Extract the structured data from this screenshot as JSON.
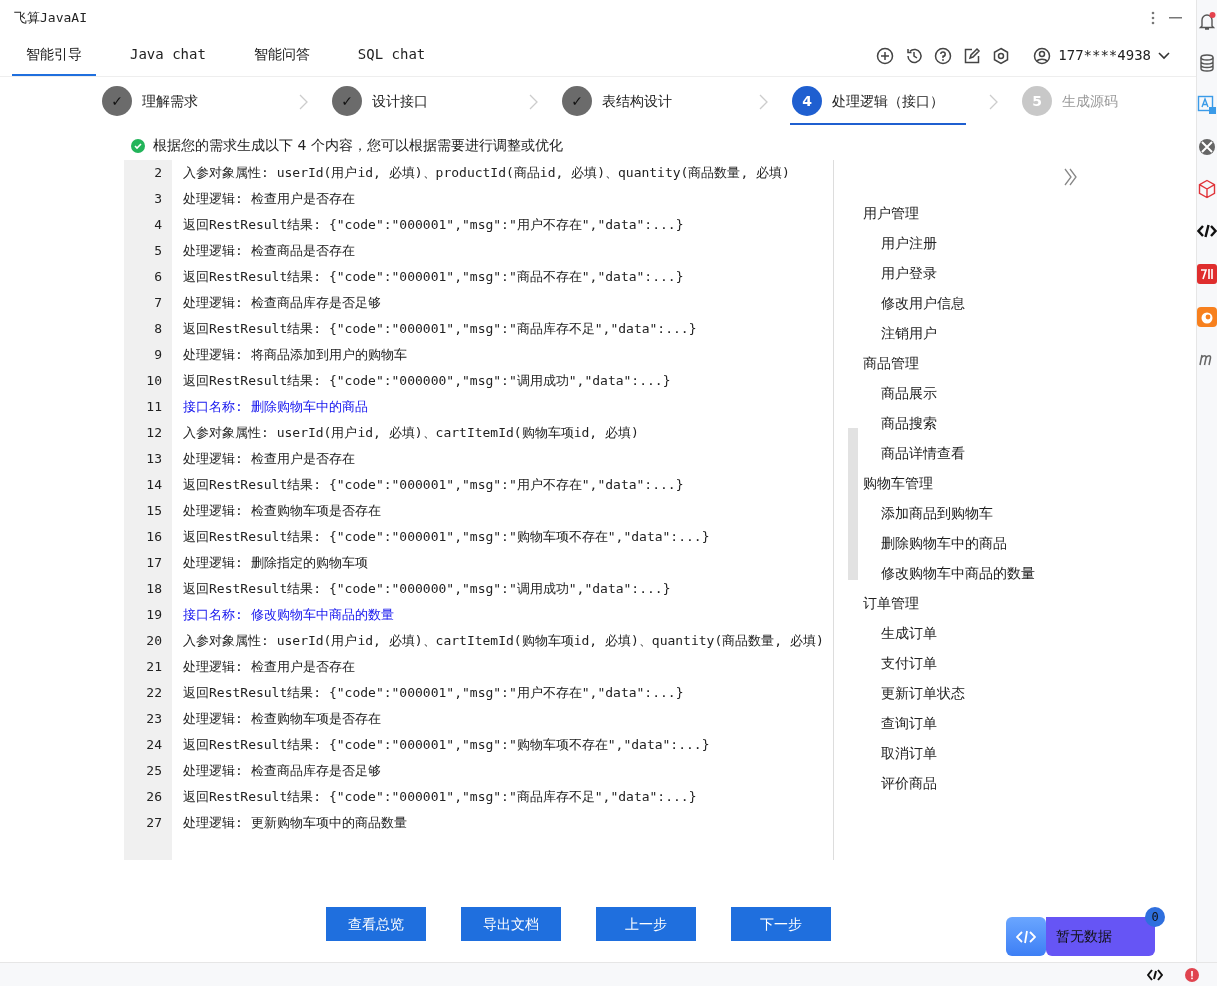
{
  "window": {
    "title": "飞算JavaAI"
  },
  "tabs": [
    {
      "label": "智能引导",
      "selected": true
    },
    {
      "label": "Java chat",
      "selected": false
    },
    {
      "label": "智能问答",
      "selected": false
    },
    {
      "label": "SQL chat",
      "selected": false
    }
  ],
  "account": {
    "label": "177****4938"
  },
  "steps": [
    {
      "marker": "✓",
      "label": "理解需求",
      "completed": true,
      "selected": false
    },
    {
      "marker": "✓",
      "label": "设计接口",
      "completed": true,
      "selected": false
    },
    {
      "marker": "✓",
      "label": "表结构设计",
      "completed": true,
      "selected": false
    },
    {
      "marker": "4",
      "label": "处理逻辑（接口）",
      "completed": false,
      "selected": true
    },
    {
      "marker": "5",
      "label": "生成源码",
      "completed": false,
      "selected": false
    }
  ],
  "message": "根据您的需求生成以下 4 个内容，您可以根据需要进行调整或优化",
  "code_lines": [
    {
      "number": "2",
      "text": "入参对象属性: userId(用户id, 必填)、productId(商品id, 必填)、quantity(商品数量, 必填)",
      "kind": "text"
    },
    {
      "number": "3",
      "text": "处理逻辑: 检查用户是否存在",
      "kind": "text"
    },
    {
      "number": "4",
      "text": "返回RestResult结果: {\"code\":\"000001\",\"msg\":\"用户不存在\",\"data\":...}",
      "kind": "text"
    },
    {
      "number": "5",
      "text": "处理逻辑: 检查商品是否存在",
      "kind": "text"
    },
    {
      "number": "6",
      "text": "返回RestResult结果: {\"code\":\"000001\",\"msg\":\"商品不存在\",\"data\":...}",
      "kind": "text"
    },
    {
      "number": "7",
      "text": "处理逻辑: 检查商品库存是否足够",
      "kind": "text"
    },
    {
      "number": "8",
      "text": "返回RestResult结果: {\"code\":\"000001\",\"msg\":\"商品库存不足\",\"data\":...}",
      "kind": "text"
    },
    {
      "number": "9",
      "text": "处理逻辑: 将商品添加到用户的购物车",
      "kind": "text"
    },
    {
      "number": "10",
      "text": "返回RestResult结果: {\"code\":\"000000\",\"msg\":\"调用成功\",\"data\":...}",
      "kind": "text"
    },
    {
      "number": "11",
      "text": "接口名称: 删除购物车中的商品",
      "kind": "heading"
    },
    {
      "number": "12",
      "text": "入参对象属性: userId(用户id, 必填)、cartItemId(购物车项id, 必填)",
      "kind": "text"
    },
    {
      "number": "13",
      "text": "处理逻辑: 检查用户是否存在",
      "kind": "text"
    },
    {
      "number": "14",
      "text": "返回RestResult结果: {\"code\":\"000001\",\"msg\":\"用户不存在\",\"data\":...}",
      "kind": "text"
    },
    {
      "number": "15",
      "text": "处理逻辑: 检查购物车项是否存在",
      "kind": "text"
    },
    {
      "number": "16",
      "text": "返回RestResult结果: {\"code\":\"000001\",\"msg\":\"购物车项不存在\",\"data\":...}",
      "kind": "text"
    },
    {
      "number": "17",
      "text": "处理逻辑: 删除指定的购物车项",
      "kind": "text"
    },
    {
      "number": "18",
      "text": "返回RestResult结果: {\"code\":\"000000\",\"msg\":\"调用成功\",\"data\":...}",
      "kind": "text"
    },
    {
      "number": "19",
      "text": "接口名称: 修改购物车中商品的数量",
      "kind": "heading"
    },
    {
      "number": "20",
      "text": "入参对象属性: userId(用户id, 必填)、cartItemId(购物车项id, 必填)、quantity(商品数量, 必填)",
      "kind": "text"
    },
    {
      "number": "21",
      "text": "处理逻辑: 检查用户是否存在",
      "kind": "text"
    },
    {
      "number": "22",
      "text": "返回RestResult结果: {\"code\":\"000001\",\"msg\":\"用户不存在\",\"data\":...}",
      "kind": "text"
    },
    {
      "number": "23",
      "text": "处理逻辑: 检查购物车项是否存在",
      "kind": "text"
    },
    {
      "number": "24",
      "text": "返回RestResult结果: {\"code\":\"000001\",\"msg\":\"购物车项不存在\",\"data\":...}",
      "kind": "text"
    },
    {
      "number": "25",
      "text": "处理逻辑: 检查商品库存是否足够",
      "kind": "text"
    },
    {
      "number": "26",
      "text": "返回RestResult结果: {\"code\":\"000001\",\"msg\":\"商品库存不足\",\"data\":...}",
      "kind": "text"
    },
    {
      "number": "27",
      "text": "处理逻辑: 更新购物车项中的商品数量",
      "kind": "text"
    }
  ],
  "outline": [
    {
      "label": "用户管理",
      "children": [
        {
          "label": "用户注册"
        },
        {
          "label": "用户登录"
        },
        {
          "label": "修改用户信息"
        },
        {
          "label": "注销用户"
        }
      ]
    },
    {
      "label": "商品管理",
      "children": [
        {
          "label": "商品展示"
        },
        {
          "label": "商品搜索"
        },
        {
          "label": "商品详情查看"
        }
      ]
    },
    {
      "label": "购物车管理",
      "children": [
        {
          "label": "添加商品到购物车"
        },
        {
          "label": "删除购物车中的商品"
        },
        {
          "label": "修改购物车中商品的数量"
        }
      ]
    },
    {
      "label": "订单管理",
      "children": [
        {
          "label": "生成订单"
        },
        {
          "label": "支付订单"
        },
        {
          "label": "更新订单状态"
        },
        {
          "label": "查询订单"
        },
        {
          "label": "取消订单"
        },
        {
          "label": "评价商品"
        }
      ]
    }
  ],
  "buttons": [
    "查看总览",
    "导出文档",
    "上一步",
    "下一步"
  ],
  "widget": {
    "label": "暂无数据",
    "count": "0"
  }
}
